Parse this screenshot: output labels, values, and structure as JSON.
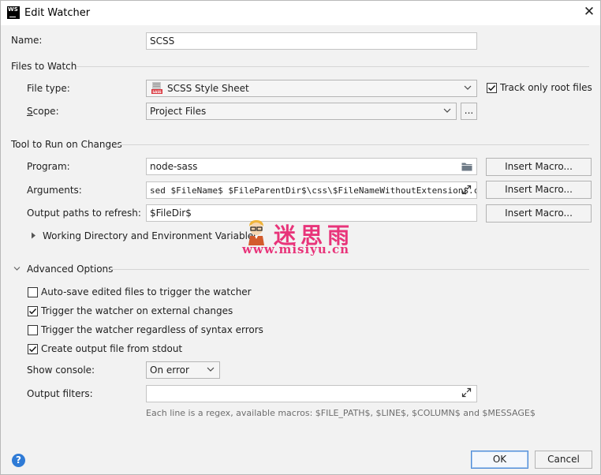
{
  "window": {
    "title": "Edit Watcher",
    "app_icon": "WS"
  },
  "name": {
    "label": "Name:",
    "value": "SCSS"
  },
  "files_to_watch": {
    "header": "Files to Watch",
    "file_type_label": "File type:",
    "file_type_value": "SCSS Style Sheet",
    "file_type_icon_text": "SASS",
    "track_root_label": "Track only root files",
    "track_root_checked": true,
    "scope_label": "Scope:",
    "scope_value": "Project Files",
    "scope_more": "..."
  },
  "tool": {
    "header": "Tool to Run on Changes",
    "program_label": "Program:",
    "program_value": "node-sass",
    "arguments_label": "Arguments:",
    "arguments_value": "sed $FileName$ $FileParentDir$\\css\\$FileNameWithoutExtension$.css",
    "output_label": "Output paths to refresh:",
    "output_value": "$FileDir$",
    "insert_macro": "Insert Macro...",
    "working_dir_label": "Working Directory and Environment Variables"
  },
  "advanced": {
    "header": "Advanced Options",
    "options": [
      {
        "label": "Auto-save edited files to trigger the watcher",
        "checked": false
      },
      {
        "label": "Trigger the watcher on external changes",
        "checked": true
      },
      {
        "label": "Trigger the watcher regardless of syntax errors",
        "checked": false
      },
      {
        "label": "Create output file from stdout",
        "checked": true
      }
    ],
    "show_console_label": "Show console:",
    "show_console_value": "On error",
    "output_filters_label": "Output filters:",
    "output_filters_value": "",
    "hint": "Each line is a regex, available macros: $FILE_PATH$, $LINE$, $COLUMN$ and $MESSAGE$"
  },
  "footer": {
    "ok": "OK",
    "cancel": "Cancel",
    "help": "?"
  },
  "watermark": {
    "cn": "迷思雨",
    "url": "www.misiyu.cn"
  },
  "colors": {
    "accent": "#4c8ad8",
    "help": "#2f7bd6",
    "watermark": "#e8347a"
  }
}
